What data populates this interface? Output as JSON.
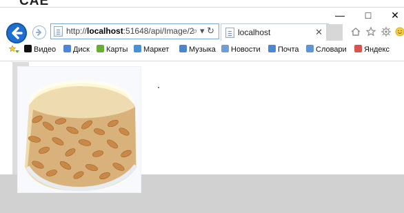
{
  "window": {
    "title_fragment": "CAE",
    "controls": [
      "—",
      "□",
      "✕"
    ]
  },
  "navigation": {
    "address": {
      "prefix": "http://",
      "host": "localhost",
      "rest": ":51648/api/Image/2"
    },
    "tools": "⌕ ▾ ↻",
    "tab_label": "localhost",
    "tab_close": "✕"
  },
  "favorites": [
    {
      "label": "Видео",
      "icon": "video-icon",
      "color": "#111111"
    },
    {
      "label": "Диск",
      "icon": "disk-icon",
      "color": "#4f86d9"
    },
    {
      "label": "Карты",
      "icon": "maps-icon",
      "color": "#69ae34"
    },
    {
      "label": "Маркет",
      "icon": "market-icon",
      "color": "#4b8fd6"
    },
    {
      "label": "Музыка",
      "icon": "music-icon",
      "color": "#4d84ce"
    },
    {
      "label": "Новости",
      "icon": "news-icon",
      "color": "#6d9ed7"
    },
    {
      "label": "Почта",
      "icon": "mail-icon",
      "color": "#4a87d4"
    },
    {
      "label": "Словари",
      "icon": "dictionary-icon",
      "color": "#5f95d5"
    },
    {
      "label": "Яндекс",
      "icon": "yandex-icon",
      "color": "#d9534f"
    }
  ],
  "colors": {
    "accent": "#1f6fd0",
    "gray_band": "#d1d1d1"
  }
}
